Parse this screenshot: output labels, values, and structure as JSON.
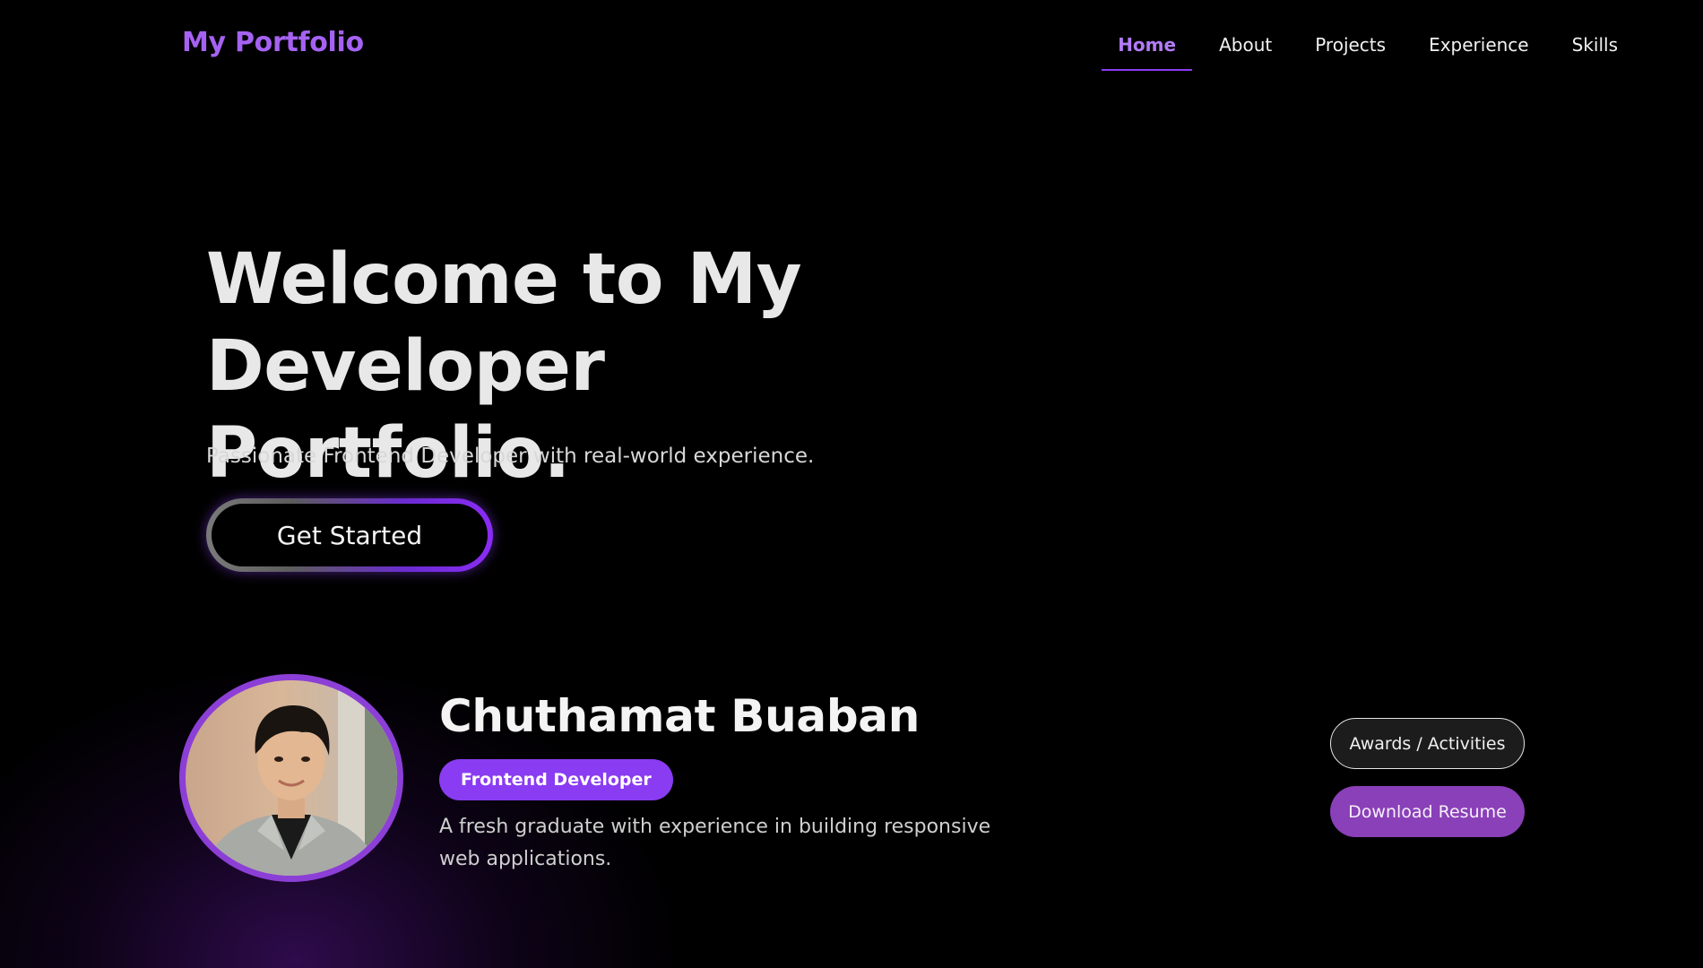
{
  "nav": {
    "brand": "My Portfolio",
    "links": [
      {
        "label": "Home",
        "active": true
      },
      {
        "label": "About",
        "active": false
      },
      {
        "label": "Projects",
        "active": false
      },
      {
        "label": "Experience",
        "active": false
      },
      {
        "label": "Skills",
        "active": false
      }
    ]
  },
  "hero": {
    "title_line1": "Welcome to My Developer",
    "title_line2": "Portfolio.",
    "subtitle": "Passionate Frontend Developer with real-world experience.",
    "cta_label": "Get Started"
  },
  "profile": {
    "name": "Chuthamat Buaban",
    "role": "Frontend Developer",
    "bio": "A fresh graduate with experience in building responsive web applications.",
    "awards_label": "Awards / Activities",
    "resume_label": "Download Resume"
  },
  "colors": {
    "background": "#000000",
    "accent": "#8a3cf2",
    "brand": "#a562f2",
    "nav_active": "#b27cf7",
    "resume_button": "#8a40b8"
  },
  "icons": {
    "avatar": "profile-photo"
  }
}
